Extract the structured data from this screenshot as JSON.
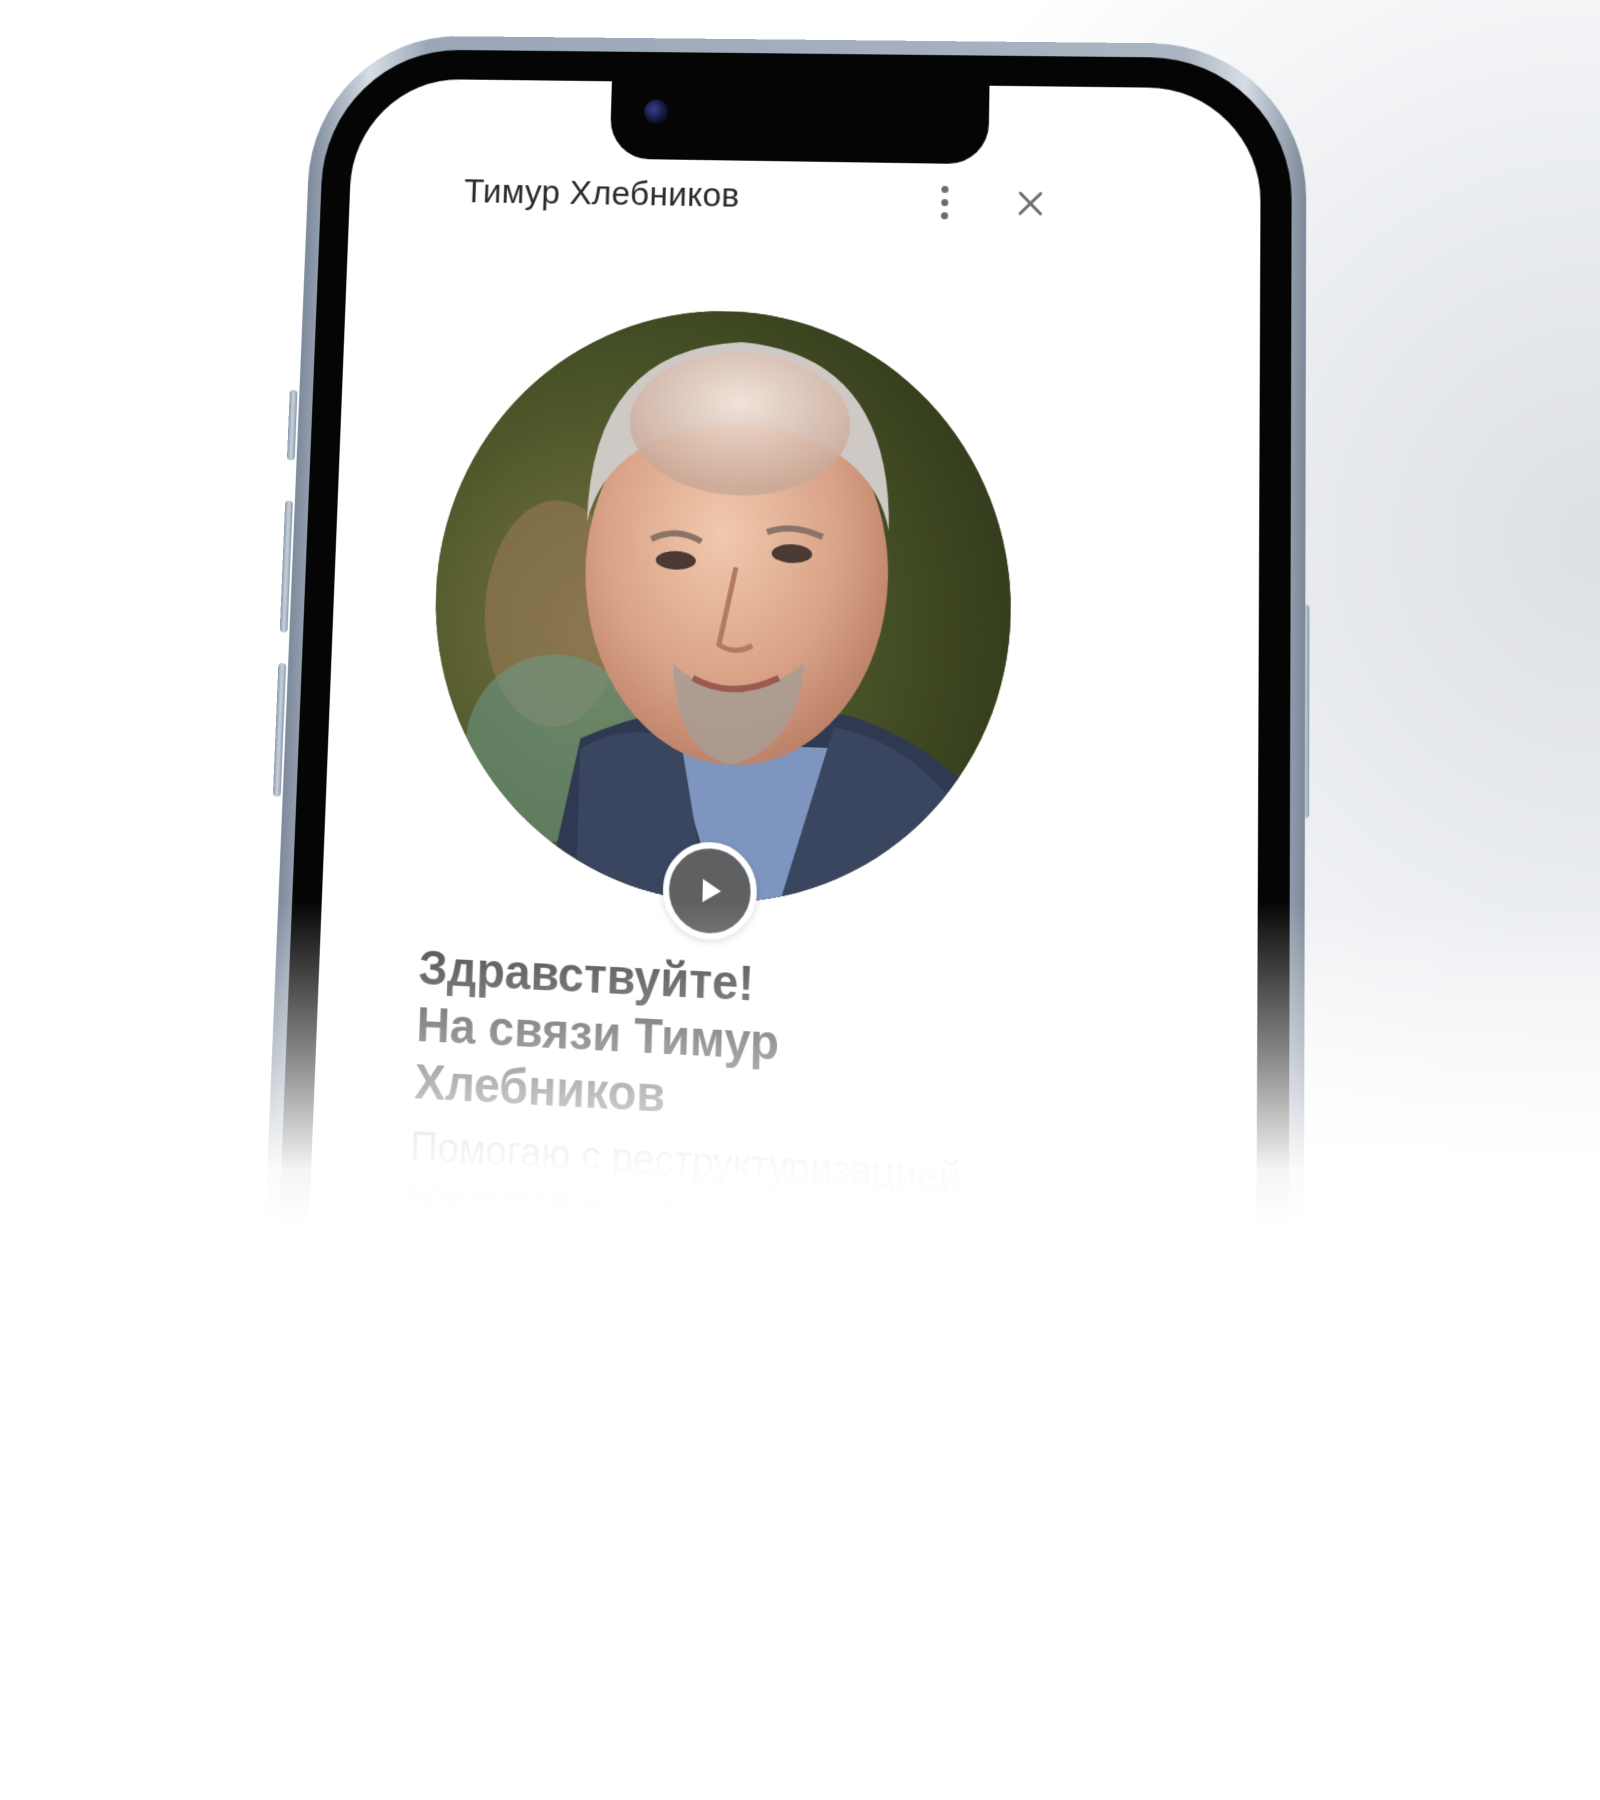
{
  "header": {
    "title": "Тимур Хлебников",
    "more_icon": "more-vertical-icon",
    "close_icon": "close-icon"
  },
  "profile": {
    "avatar": "profile-photo",
    "play_icon": "play-icon"
  },
  "content": {
    "greeting_line1": "Здравствуйте!",
    "greeting_line2": "На связи Тимур",
    "greeting_line3": "Хлебников",
    "description_line1": "Помогаю с реструктуризацией",
    "description_line2": "кредитов юридических лиц"
  },
  "colors": {
    "accent_dark": "#3a3a3a",
    "muted_text": "#9a9a9a",
    "play_button": "#5e6062"
  }
}
